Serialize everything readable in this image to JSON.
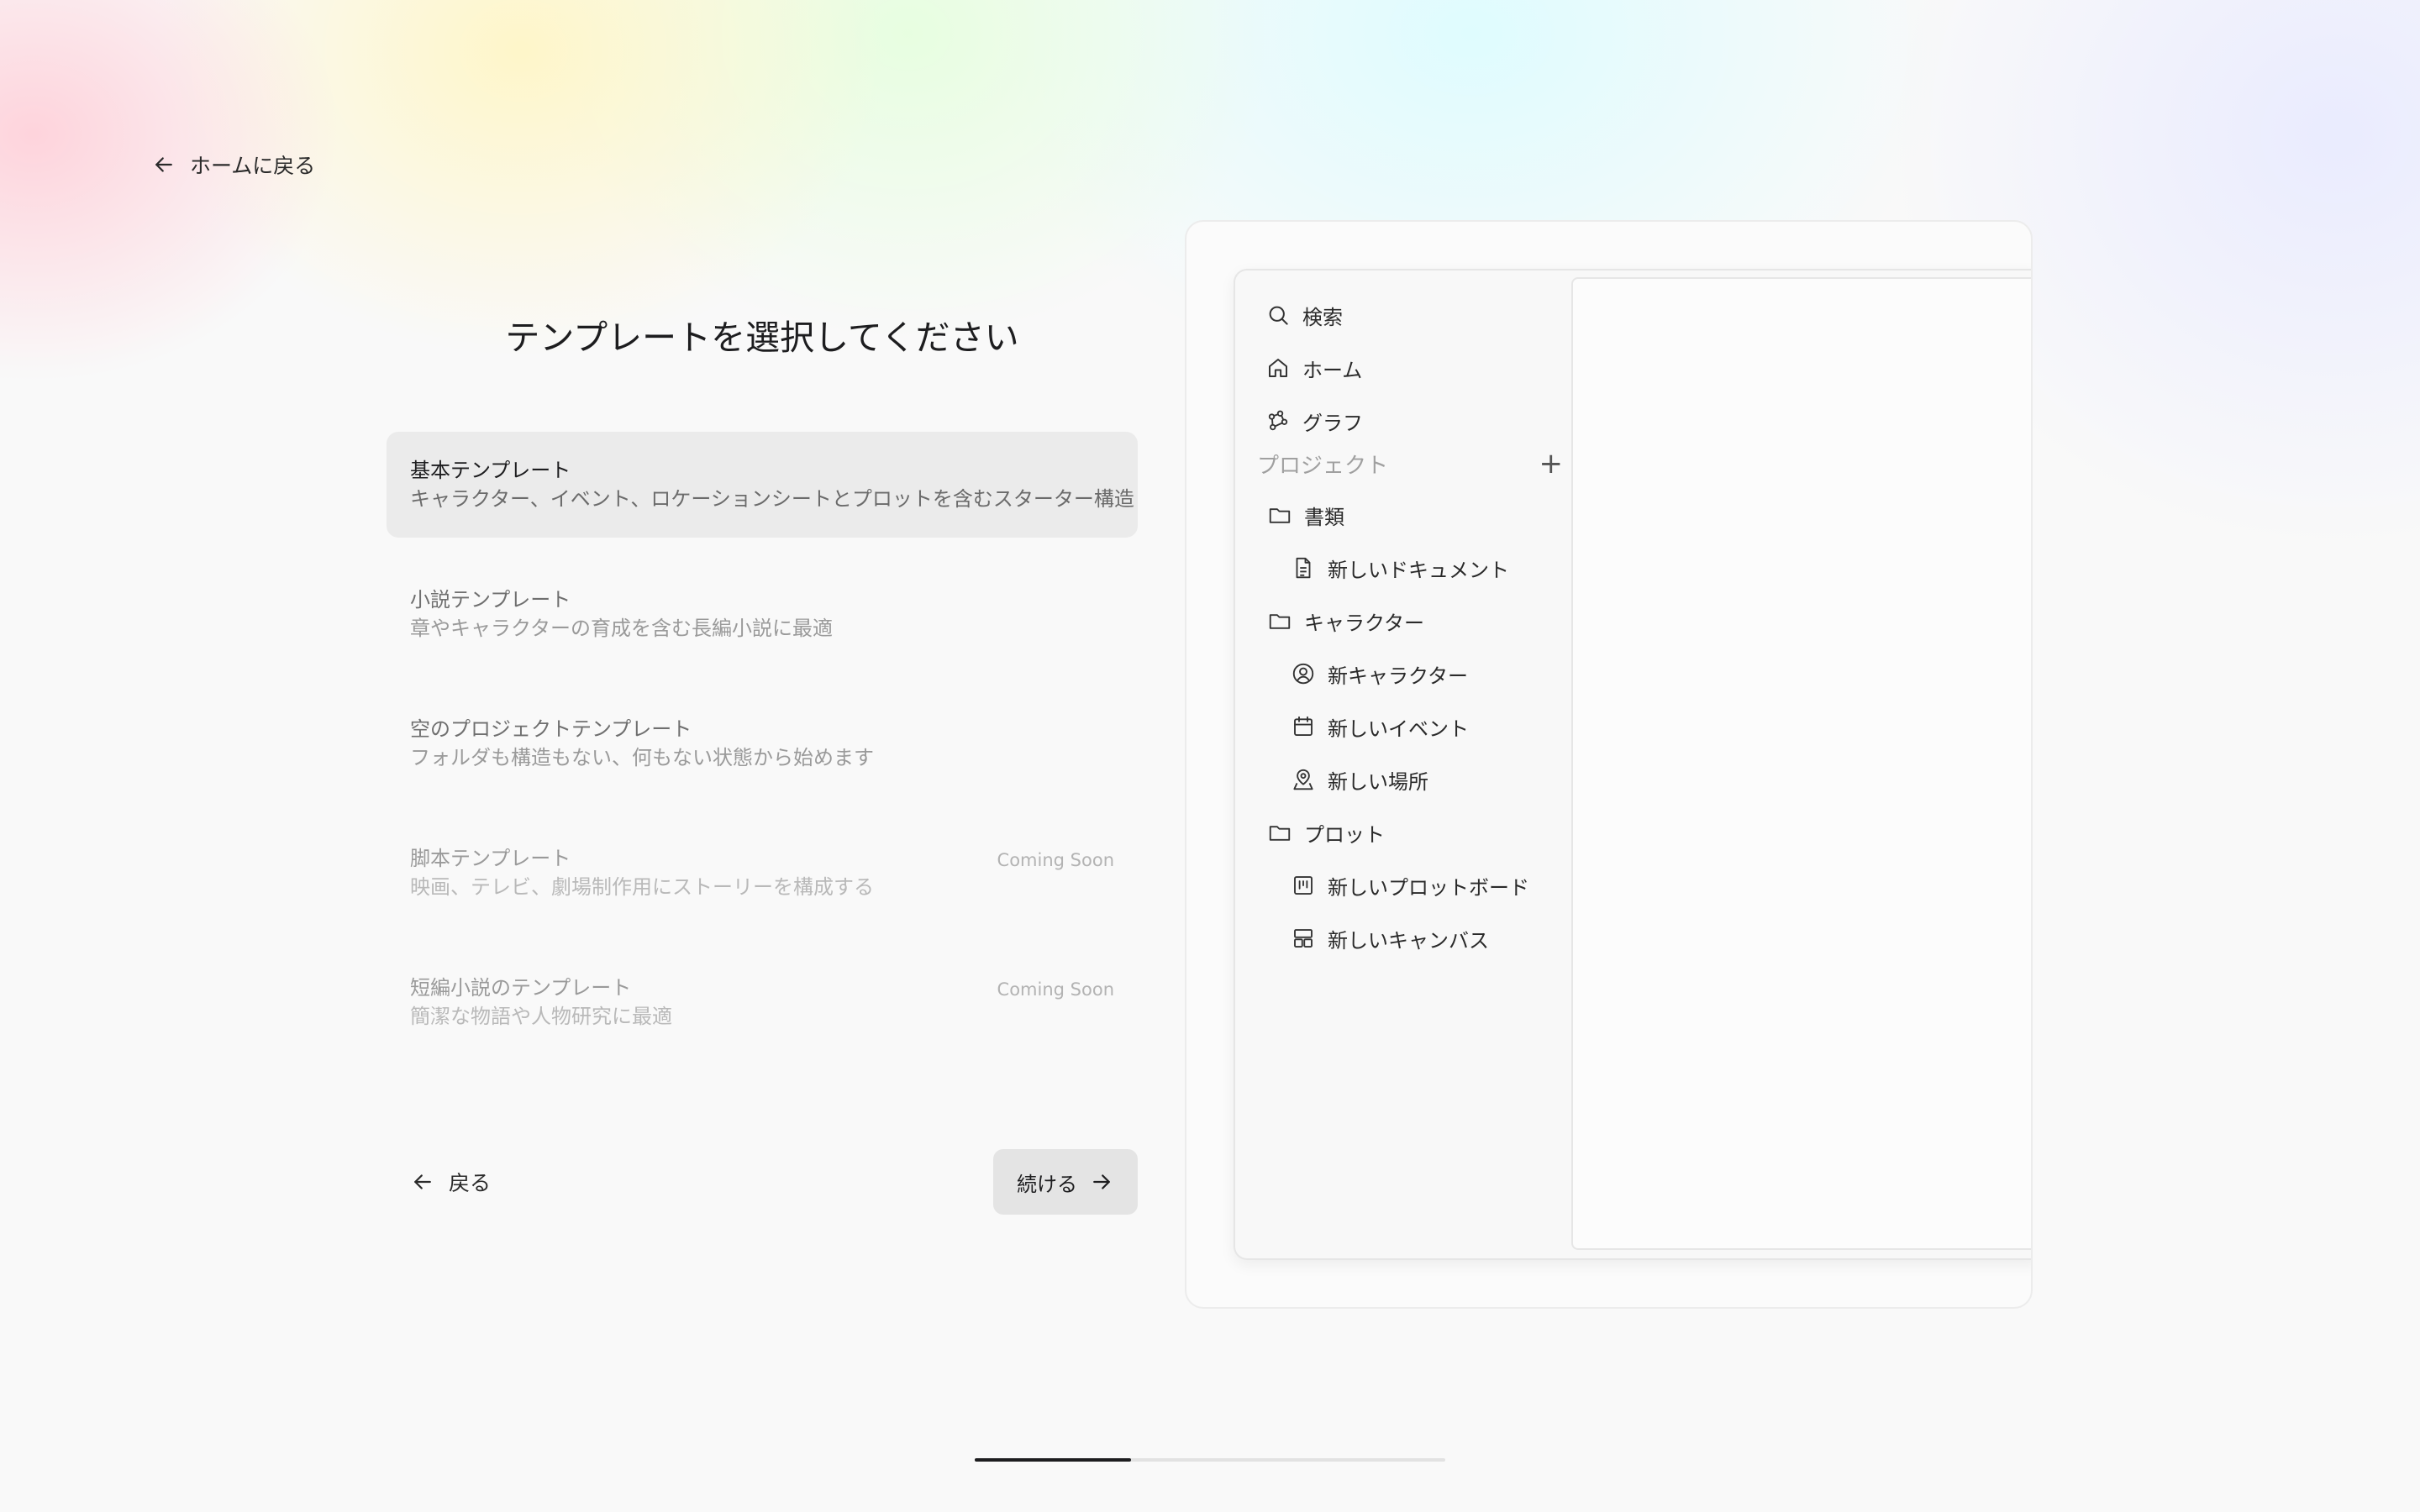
{
  "nav": {
    "back_home": "ホームに戻る"
  },
  "page": {
    "title": "テンプレートを選択してください"
  },
  "templates": [
    {
      "title": "基本テンプレート",
      "description": "キャラクター、イベント、ロケーションシートとプロットを含むスターター構造",
      "status": ""
    },
    {
      "title": "小説テンプレート",
      "description": "章やキャラクターの育成を含む長編小説に最適",
      "status": ""
    },
    {
      "title": "空のプロジェクトテンプレート",
      "description": "フォルダも構造もない、何もない状態から始めます",
      "status": ""
    },
    {
      "title": "脚本テンプレート",
      "description": "映画、テレビ、劇場制作用にストーリーを構成する",
      "status": "Coming Soon"
    },
    {
      "title": "短編小説のテンプレート",
      "description": "簡潔な物語や人物研究に最適",
      "status": "Coming Soon"
    }
  ],
  "actions": {
    "back": "戻る",
    "continue": "続ける"
  },
  "preview": {
    "search": "検索",
    "home": "ホーム",
    "graph": "グラフ",
    "projects_header": "プロジェクト",
    "add": "+",
    "tree": [
      {
        "label": "書類",
        "icon": "folder-icon"
      },
      {
        "label": "新しいドキュメント",
        "icon": "document-icon"
      },
      {
        "label": "キャラクター",
        "icon": "folder-icon"
      },
      {
        "label": "新キャラクター",
        "icon": "user-circle-icon"
      },
      {
        "label": "新しいイベント",
        "icon": "calendar-icon"
      },
      {
        "label": "新しい場所",
        "icon": "map-pin-icon"
      },
      {
        "label": "プロット",
        "icon": "folder-icon"
      },
      {
        "label": "新しいプロットボード",
        "icon": "kanban-icon"
      },
      {
        "label": "新しいキャンバス",
        "icon": "layout-icon"
      }
    ]
  },
  "progress": {
    "step_fraction": 0.333
  }
}
